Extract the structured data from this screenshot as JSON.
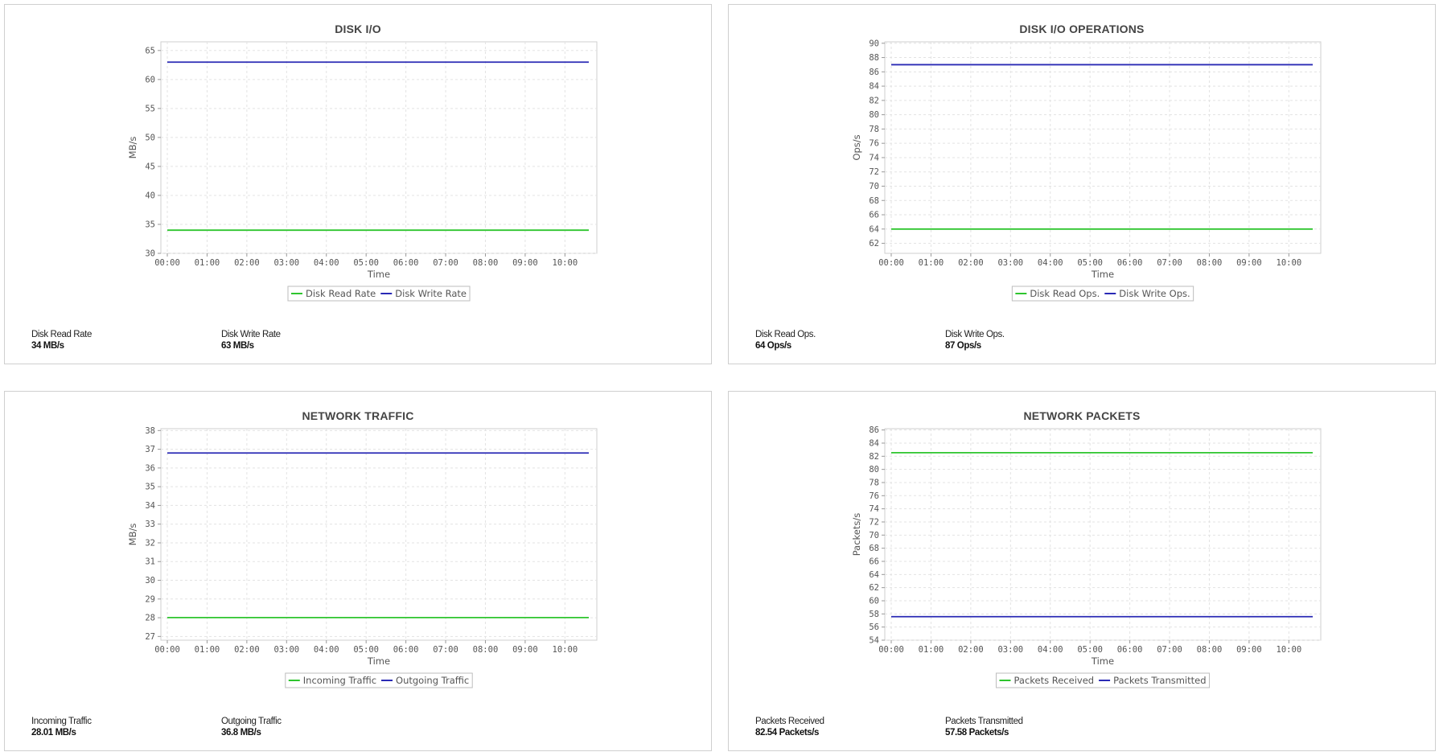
{
  "colors": {
    "series_green": "#2ec52e",
    "series_blue": "#2a2ab5"
  },
  "chart_data": [
    {
      "type": "line",
      "title": "DISK I/O",
      "xlabel": "Time",
      "ylabel": "MB/s",
      "x_ticks": [
        "00:00",
        "01:00",
        "02:00",
        "03:00",
        "04:00",
        "05:00",
        "06:00",
        "07:00",
        "08:00",
        "09:00",
        "10:00"
      ],
      "x_range": [
        0,
        10.6
      ],
      "ylim": [
        30,
        66.5
      ],
      "y_ticks": [
        30,
        35,
        40,
        45,
        50,
        55,
        60,
        65
      ],
      "grid": true,
      "legend": "bottom-center",
      "series": [
        {
          "name": "Disk Read Rate",
          "color": "#2ec52e",
          "x": [
            0,
            10.6
          ],
          "y": [
            34,
            34
          ]
        },
        {
          "name": "Disk Write Rate",
          "color": "#2a2ab5",
          "x": [
            0,
            10.6
          ],
          "y": [
            63,
            63
          ]
        }
      ],
      "stats": [
        {
          "label": "Disk Read Rate",
          "value": "34 MB/s"
        },
        {
          "label": "Disk Write Rate",
          "value": "63 MB/s"
        }
      ]
    },
    {
      "type": "line",
      "title": "DISK I/O OPERATIONS",
      "xlabel": "Time",
      "ylabel": "Ops/s",
      "x_ticks": [
        "00:00",
        "01:00",
        "02:00",
        "03:00",
        "04:00",
        "05:00",
        "06:00",
        "07:00",
        "08:00",
        "09:00",
        "10:00"
      ],
      "x_range": [
        0,
        10.6
      ],
      "ylim": [
        60.6,
        90.2
      ],
      "y_ticks": [
        62,
        64,
        66,
        68,
        70,
        72,
        74,
        76,
        78,
        80,
        82,
        84,
        86,
        88,
        90
      ],
      "grid": true,
      "legend": "bottom-center",
      "series": [
        {
          "name": "Disk Read Ops.",
          "color": "#2ec52e",
          "x": [
            0,
            10.6
          ],
          "y": [
            64,
            64
          ]
        },
        {
          "name": "Disk Write Ops.",
          "color": "#2a2ab5",
          "x": [
            0,
            10.6
          ],
          "y": [
            87,
            87
          ]
        }
      ],
      "stats": [
        {
          "label": "Disk Read Ops.",
          "value": "64 Ops/s"
        },
        {
          "label": "Disk Write Ops.",
          "value": "87 Ops/s"
        }
      ]
    },
    {
      "type": "line",
      "title": "NETWORK TRAFFIC",
      "xlabel": "Time",
      "ylabel": "MB/s",
      "x_ticks": [
        "00:00",
        "01:00",
        "02:00",
        "03:00",
        "04:00",
        "05:00",
        "06:00",
        "07:00",
        "08:00",
        "09:00",
        "10:00"
      ],
      "x_range": [
        0,
        10.6
      ],
      "ylim": [
        26.8,
        38.1
      ],
      "y_ticks": [
        27,
        28,
        29,
        30,
        31,
        32,
        33,
        34,
        35,
        36,
        37,
        38
      ],
      "grid": true,
      "legend": "bottom-center",
      "series": [
        {
          "name": "Incoming Traffic",
          "color": "#2ec52e",
          "x": [
            0,
            10.6
          ],
          "y": [
            28.01,
            28.01
          ]
        },
        {
          "name": "Outgoing Traffic",
          "color": "#2a2ab5",
          "x": [
            0,
            10.6
          ],
          "y": [
            36.8,
            36.8
          ]
        }
      ],
      "stats": [
        {
          "label": "Incoming Traffic",
          "value": "28.01 MB/s"
        },
        {
          "label": "Outgoing Traffic",
          "value": "36.8 MB/s"
        }
      ]
    },
    {
      "type": "line",
      "title": "NETWORK PACKETS",
      "xlabel": "Time",
      "ylabel": "Packets/s",
      "x_ticks": [
        "00:00",
        "01:00",
        "02:00",
        "03:00",
        "04:00",
        "05:00",
        "06:00",
        "07:00",
        "08:00",
        "09:00",
        "10:00"
      ],
      "x_range": [
        0,
        10.6
      ],
      "ylim": [
        54,
        86.2
      ],
      "y_ticks": [
        54,
        56,
        58,
        60,
        62,
        64,
        66,
        68,
        70,
        72,
        74,
        76,
        78,
        80,
        82,
        84,
        86
      ],
      "grid": true,
      "legend": "bottom-center",
      "series": [
        {
          "name": "Packets Received",
          "color": "#2ec52e",
          "x": [
            0,
            10.6
          ],
          "y": [
            82.54,
            82.54
          ]
        },
        {
          "name": "Packets Transmitted",
          "color": "#2a2ab5",
          "x": [
            0,
            10.6
          ],
          "y": [
            57.58,
            57.58
          ]
        }
      ],
      "stats": [
        {
          "label": "Packets Received",
          "value": "82.54 Packets/s"
        },
        {
          "label": "Packets Transmitted",
          "value": "57.58 Packets/s"
        }
      ]
    }
  ]
}
